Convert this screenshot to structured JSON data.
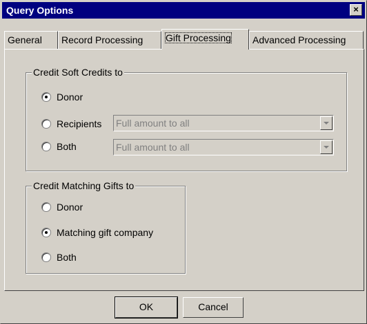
{
  "window": {
    "title": "Query Options",
    "close_label": "×"
  },
  "tabs": [
    {
      "label": "General"
    },
    {
      "label": "Record Processing"
    },
    {
      "label": "Gift Processing",
      "active": true
    },
    {
      "label": "Advanced Processing"
    }
  ],
  "soft_credits": {
    "legend": "Credit Soft Credits to",
    "options": [
      {
        "label": "Donor",
        "checked": true
      },
      {
        "label": "Recipients",
        "checked": false,
        "combo_value": "Full amount to all"
      },
      {
        "label": "Both",
        "checked": false,
        "combo_value": "Full amount to all"
      }
    ]
  },
  "matching_gifts": {
    "legend": "Credit Matching Gifts to",
    "options": [
      {
        "label": "Donor",
        "checked": false
      },
      {
        "label": "Matching gift company",
        "checked": true
      },
      {
        "label": "Both",
        "checked": false
      }
    ]
  },
  "buttons": {
    "ok": "OK",
    "cancel": "Cancel"
  }
}
